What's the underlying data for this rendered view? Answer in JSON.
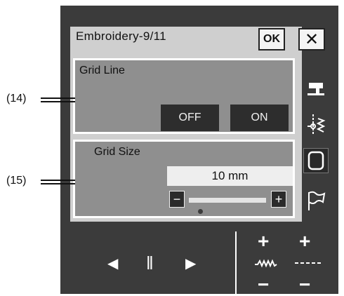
{
  "header": {
    "title": "Embroidery-9/11",
    "ok_label": "OK",
    "close_label": "✕"
  },
  "grid_line": {
    "label": "Grid Line",
    "off_label": "OFF",
    "on_label": "ON",
    "callout": "(14)"
  },
  "grid_size": {
    "label": "Grid Size",
    "value": "10 mm",
    "minus_label": "−",
    "plus_label": "+",
    "callout": "(15)"
  },
  "sidebar": {
    "icons": [
      "sewing-machine-icon",
      "embroidery-stitch-icon",
      "screen-frame-icon",
      "flag-icon"
    ]
  },
  "bottom_nav": {
    "prev_label": "◀",
    "pause_label": "‖",
    "next_label": "▶"
  },
  "adjust": {
    "left_plus": "+",
    "left_minus": "−",
    "right_plus": "+",
    "right_minus": "−"
  }
}
